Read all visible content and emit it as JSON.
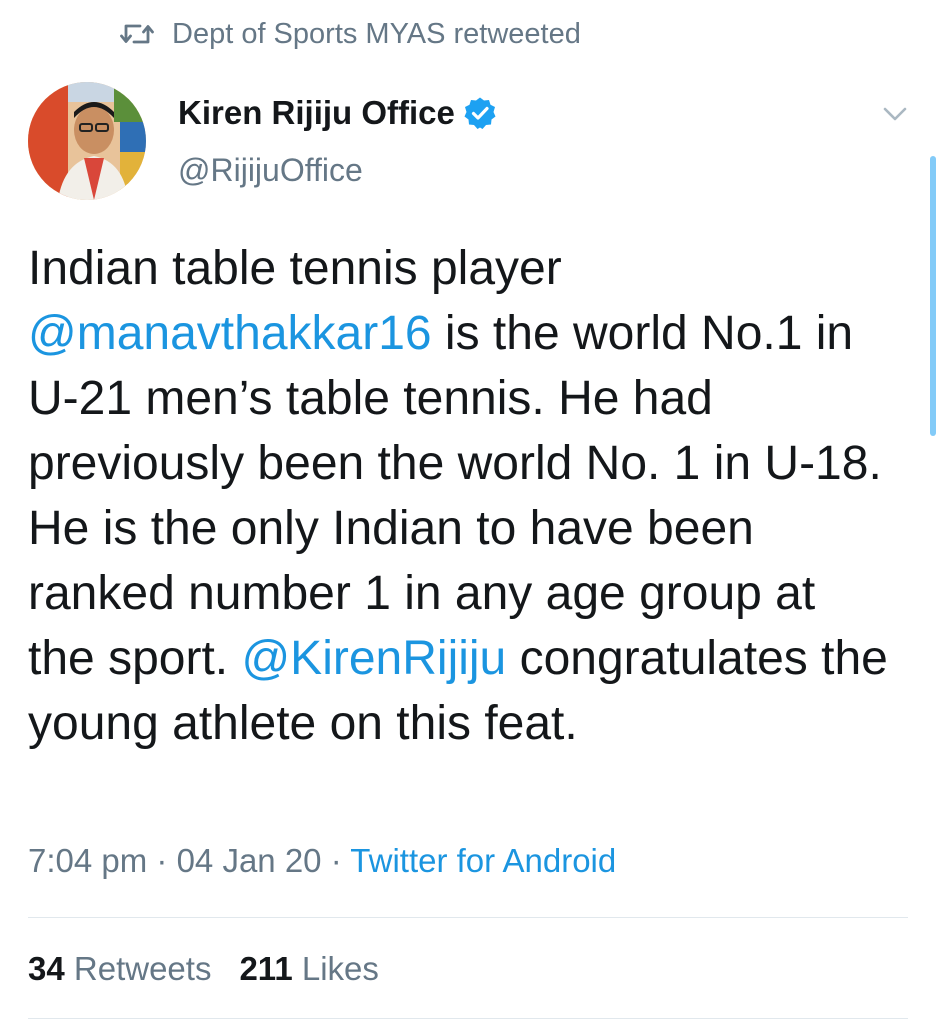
{
  "retweet_bar": {
    "icon": "retweet-icon",
    "text": "Dept of Sports MYAS retweeted"
  },
  "author": {
    "avatar": "profile-avatar",
    "name": "Kiren Rijiju Office",
    "verified_icon": "verified-badge-icon",
    "handle": "@RijijuOffice"
  },
  "tweet": {
    "parts": [
      "Indian table tennis player ",
      "@manavthakkar16",
      " is the world No.1 in U-21 men’s table tennis. He had previously been the world No. 1 in U-18. He is the only Indian to have been ranked number 1 in any age group at the sport. ",
      "@KirenRijiju",
      " congratulates the young athlete on this feat."
    ]
  },
  "meta": {
    "time": "7:04 pm",
    "sep1": " · ",
    "date": "04 Jan 20",
    "sep2": " · ",
    "source": "Twitter for Android"
  },
  "stats": {
    "retweets_count": "34",
    "retweets_label": "Retweets",
    "likes_count": "211",
    "likes_label": "Likes"
  },
  "colors": {
    "link": "#1b95e0",
    "muted": "#657786",
    "text": "#14171a",
    "verified": "#1da1f2"
  }
}
